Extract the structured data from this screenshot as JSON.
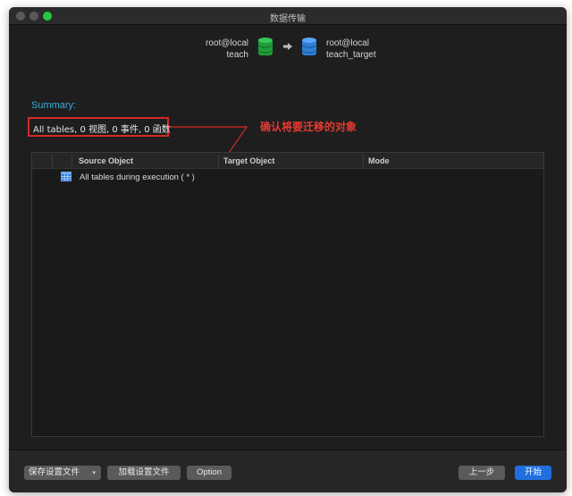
{
  "window": {
    "title": "数据传输"
  },
  "header": {
    "source": {
      "connection": "root@local",
      "database": "teach",
      "icon": "database-green-icon"
    },
    "target": {
      "connection": "root@local",
      "database": "teach_target",
      "icon": "database-blue-icon"
    },
    "arrow_icon": "arrow-right-icon"
  },
  "summary": {
    "label": "Summary:",
    "text": "All tables, 0 视图, 0 事件, 0 函数"
  },
  "annotation": {
    "text": "确认将要迁移的对象",
    "color": "#e63a30"
  },
  "table": {
    "columns": [
      "Source Object",
      "Target Object",
      "Mode"
    ],
    "rows": [
      {
        "icon": "table-grid-icon",
        "source": "All tables during execution ( * )",
        "target": "",
        "mode": ""
      }
    ]
  },
  "footer": {
    "save_profile": "保存设置文件",
    "load_profile": "加载设置文件",
    "option": "Option",
    "back": "上一步",
    "start": "开始"
  },
  "colors": {
    "accent": "#1f6fe0",
    "summary_label": "#3fa9d8",
    "highlight_border": "#d42a24",
    "window_bg": "#1e1e1e"
  }
}
